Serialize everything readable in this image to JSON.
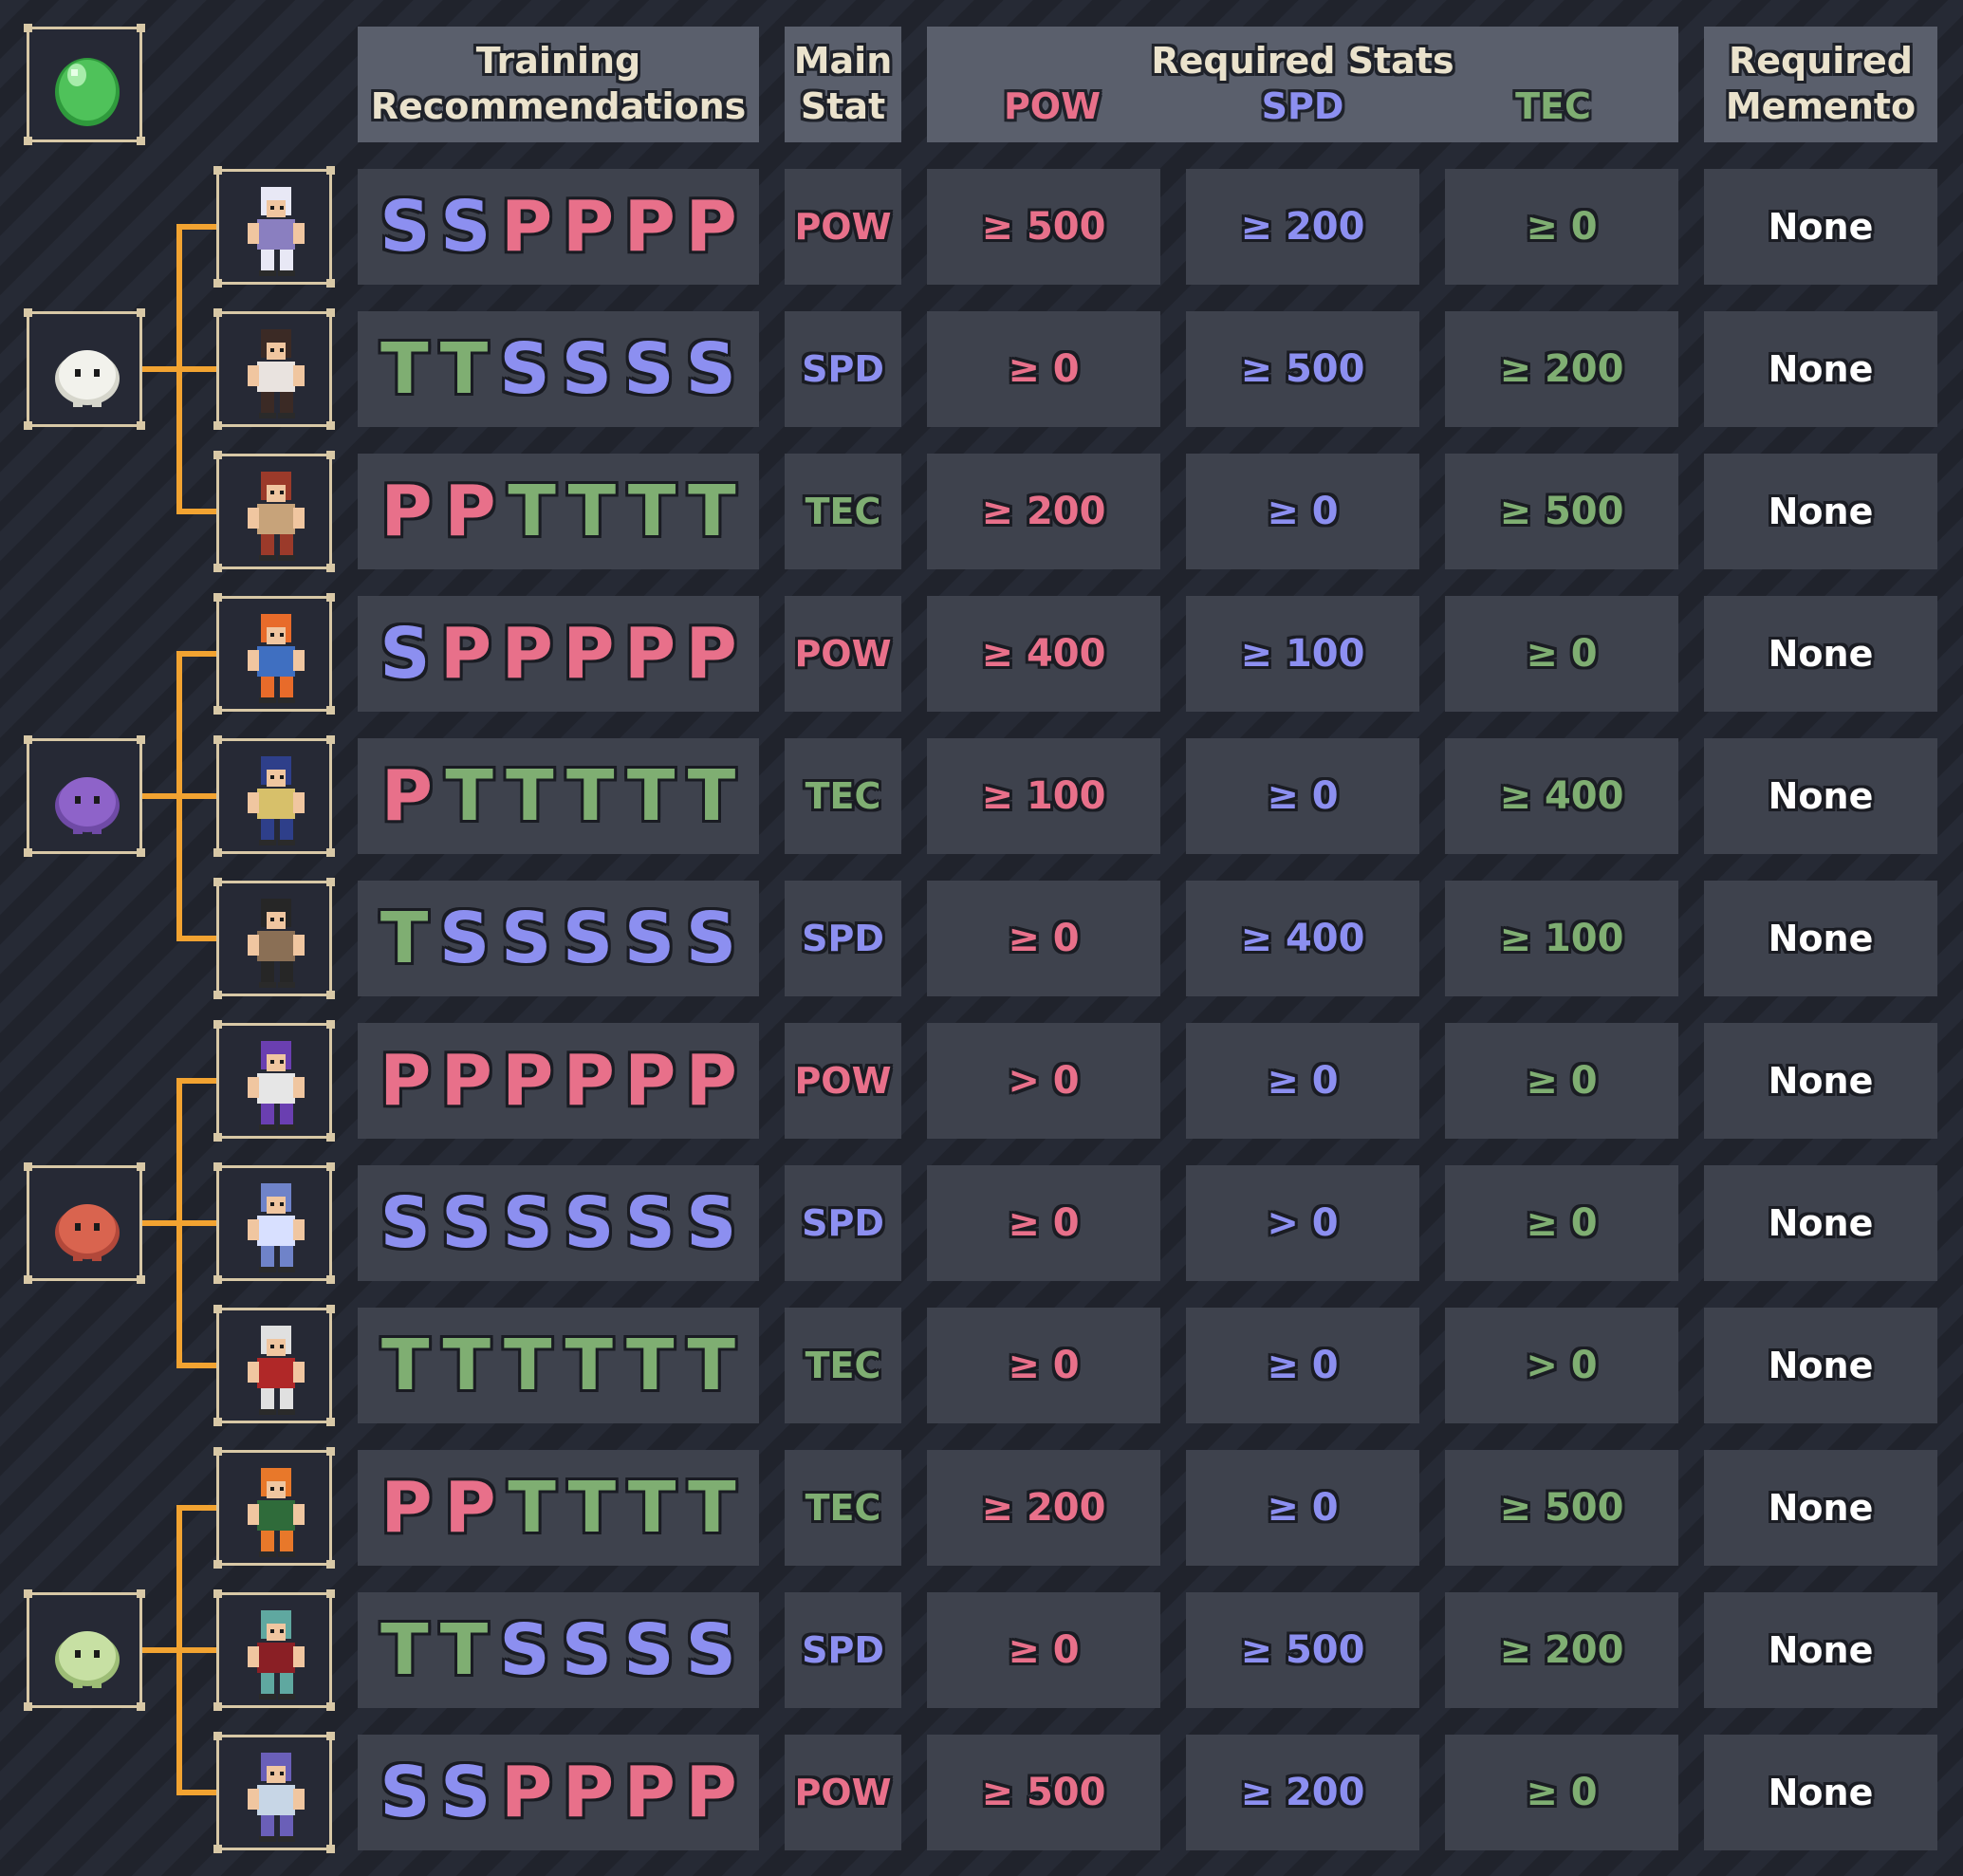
{
  "header": {
    "training_line1": "Training",
    "training_line2": "Recommendations",
    "main_line1": "Main",
    "main_line2": "Stat",
    "req_title": "Required Stats",
    "req_pow": "POW",
    "req_spd": "SPD",
    "req_tec": "TEC",
    "memento_line1": "Required",
    "memento_line2": "Memento"
  },
  "colors": {
    "pow": "#e8708a",
    "spd": "#8c8ff0",
    "tec": "#7fae72",
    "connector": "#f2a331",
    "frame": "#d8c8a6"
  },
  "icons": {
    "root": "green-egg-icon",
    "groups": [
      "white-ghost-blob-icon",
      "purple-ghost-blob-icon",
      "red-crab-blob-icon",
      "green-round-blob-icon"
    ]
  },
  "rows": [
    {
      "character_icon": "white-haired-girl-character-icon",
      "recs": [
        "S",
        "S",
        "P",
        "P",
        "P",
        "P"
      ],
      "main": "POW",
      "pow": "≥ 500",
      "spd": "≥ 200",
      "tec": "≥ 0",
      "memento": "None"
    },
    {
      "character_icon": "karate-fighter-character-icon",
      "recs": [
        "T",
        "T",
        "S",
        "S",
        "S",
        "S"
      ],
      "main": "SPD",
      "pow": "≥ 0",
      "spd": "≥ 500",
      "tec": "≥ 200",
      "memento": "None"
    },
    {
      "character_icon": "axe-warrior-character-icon",
      "recs": [
        "P",
        "P",
        "T",
        "T",
        "T",
        "T"
      ],
      "main": "TEC",
      "pow": "≥ 200",
      "spd": "≥ 0",
      "tec": "≥ 500",
      "memento": "None"
    },
    {
      "character_icon": "orange-hair-brawler-character-icon",
      "recs": [
        "S",
        "P",
        "P",
        "P",
        "P",
        "P"
      ],
      "main": "POW",
      "pow": "≥ 400",
      "spd": "≥ 100",
      "tec": "≥ 0",
      "memento": "None"
    },
    {
      "character_icon": "blue-cap-agent-character-icon",
      "recs": [
        "P",
        "T",
        "T",
        "T",
        "T",
        "T"
      ],
      "main": "TEC",
      "pow": "≥ 100",
      "spd": "≥ 0",
      "tec": "≥ 400",
      "memento": "None"
    },
    {
      "character_icon": "top-hat-gentleman-character-icon",
      "recs": [
        "T",
        "S",
        "S",
        "S",
        "S",
        "S"
      ],
      "main": "SPD",
      "pow": "≥ 0",
      "spd": "≥ 400",
      "tec": "≥ 100",
      "memento": "None"
    },
    {
      "character_icon": "purple-robed-wizard-character-icon",
      "recs": [
        "P",
        "P",
        "P",
        "P",
        "P",
        "P"
      ],
      "main": "POW",
      "pow": "> 0",
      "spd": "≥ 0",
      "tec": "≥ 0",
      "memento": "None"
    },
    {
      "character_icon": "blue-werewolf-character-icon",
      "recs": [
        "S",
        "S",
        "S",
        "S",
        "S",
        "S"
      ],
      "main": "SPD",
      "pow": "≥ 0",
      "spd": "> 0",
      "tec": "≥ 0",
      "memento": "None"
    },
    {
      "character_icon": "white-yeti-character-icon",
      "recs": [
        "T",
        "T",
        "T",
        "T",
        "T",
        "T"
      ],
      "main": "TEC",
      "pow": "≥ 0",
      "spd": "≥ 0",
      "tec": "> 0",
      "memento": "None"
    },
    {
      "character_icon": "green-hat-elf-character-icon",
      "recs": [
        "P",
        "P",
        "T",
        "T",
        "T",
        "T"
      ],
      "main": "TEC",
      "pow": "≥ 200",
      "spd": "≥ 0",
      "tec": "≥ 500",
      "memento": "None"
    },
    {
      "character_icon": "teal-hair-rogue-character-icon",
      "recs": [
        "T",
        "T",
        "S",
        "S",
        "S",
        "S"
      ],
      "main": "SPD",
      "pow": "≥ 0",
      "spd": "≥ 500",
      "tec": "≥ 200",
      "memento": "None"
    },
    {
      "character_icon": "purple-zombie-jester-character-icon",
      "recs": [
        "S",
        "S",
        "P",
        "P",
        "P",
        "P"
      ],
      "main": "POW",
      "pow": "≥ 500",
      "spd": "≥ 200",
      "tec": "≥ 0",
      "memento": "None"
    }
  ]
}
